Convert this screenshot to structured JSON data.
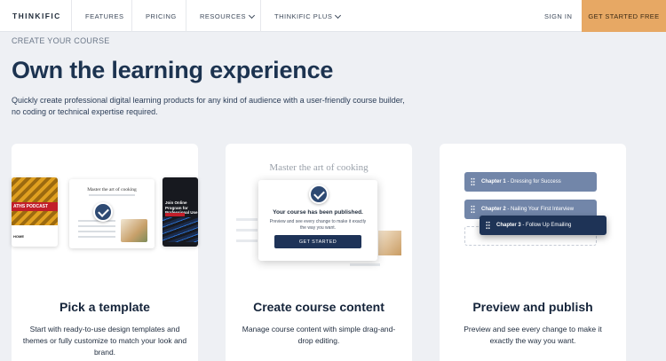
{
  "nav": {
    "brand": "THINKIFIC",
    "features": "FEATURES",
    "pricing": "PRICING",
    "resources": "RESOURCES",
    "plus": "THINKIFIC PLUS",
    "sign_in": "SIGN IN",
    "cta": "GET STARTED FREE"
  },
  "hero": {
    "eyebrow": "CREATE YOUR COURSE",
    "headline": "Own the learning experience",
    "intro": "Quickly create professional digital learning products for any kind of audience with a user-friendly course builder, no coding or technical expertise required."
  },
  "cards": [
    {
      "title": "Pick a template",
      "text": "Start with ready-to-use design templates and themes or fully customize to match your look and brand.",
      "mock": {
        "tpl1_band": "ATHS PODCAST",
        "tpl1_footer": "HOME",
        "tpl2_title": "Master the art of cooking",
        "tpl3_text": "Join Online Program for Professional Use"
      }
    },
    {
      "title": "Create course content",
      "text": "Manage course content with simple drag-and-drop editing.",
      "mock": {
        "bg_title": "Master the art of cooking",
        "modal_title": "Your course has been published.",
        "modal_text": "Preview and see every change to make it exactly the way you want.",
        "modal_button": "GET STARTED"
      }
    },
    {
      "title": "Preview and publish",
      "text": "Preview and see every change to make it exactly the way you want.",
      "chapters": [
        {
          "label": "Chapter 1",
          "name": "- Dressing for Success"
        },
        {
          "label": "Chapter 2",
          "name": "- Nailing Your First Interview"
        },
        {
          "label": "Chapter 3",
          "name": "- Follow Up Emailing"
        }
      ]
    }
  ],
  "colors": {
    "accent": "#e7a864",
    "navy": "#1e3356",
    "chapter": "#7286a9"
  }
}
